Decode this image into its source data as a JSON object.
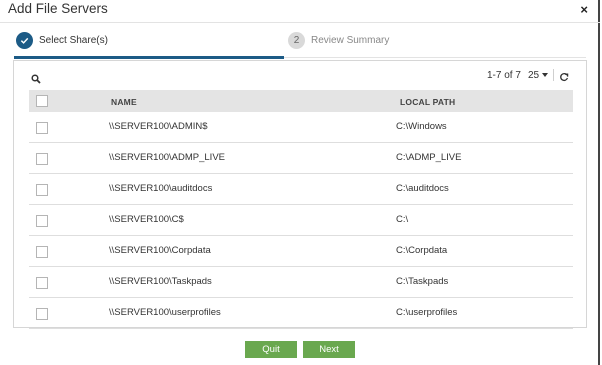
{
  "dialog": {
    "title": "Add File Servers",
    "close_glyph": "×"
  },
  "steps": [
    {
      "number": "",
      "label": "Select Share(s)",
      "state": "complete",
      "icon": "check-icon"
    },
    {
      "number": "2",
      "label": "Review Summary",
      "state": "pending"
    }
  ],
  "toolbar": {
    "search_icon": "search-icon",
    "pager_text": "1-7 of 7",
    "page_size": "25",
    "refresh_icon": "refresh-icon"
  },
  "table": {
    "columns": {
      "name": "NAME",
      "local_path": "LOCAL PATH"
    },
    "rows": [
      {
        "name": "\\\\SERVER100\\ADMIN$",
        "local_path": "C:\\Windows"
      },
      {
        "name": "\\\\SERVER100\\ADMP_LIVE",
        "local_path": "C:\\ADMP_LIVE"
      },
      {
        "name": "\\\\SERVER100\\auditdocs",
        "local_path": "C:\\auditdocs"
      },
      {
        "name": "\\\\SERVER100\\C$",
        "local_path": "C:\\"
      },
      {
        "name": "\\\\SERVER100\\Corpdata",
        "local_path": "C:\\Corpdata"
      },
      {
        "name": "\\\\SERVER100\\Taskpads",
        "local_path": "C:\\Taskpads"
      },
      {
        "name": "\\\\SERVER100\\userprofiles",
        "local_path": "C:\\userprofiles"
      }
    ]
  },
  "buttons": {
    "quit": "Quit",
    "next": "Next"
  },
  "colors": {
    "accent": "#1c5b86",
    "button_green": "#6aa84f",
    "header_bg": "#e4e4e4"
  }
}
